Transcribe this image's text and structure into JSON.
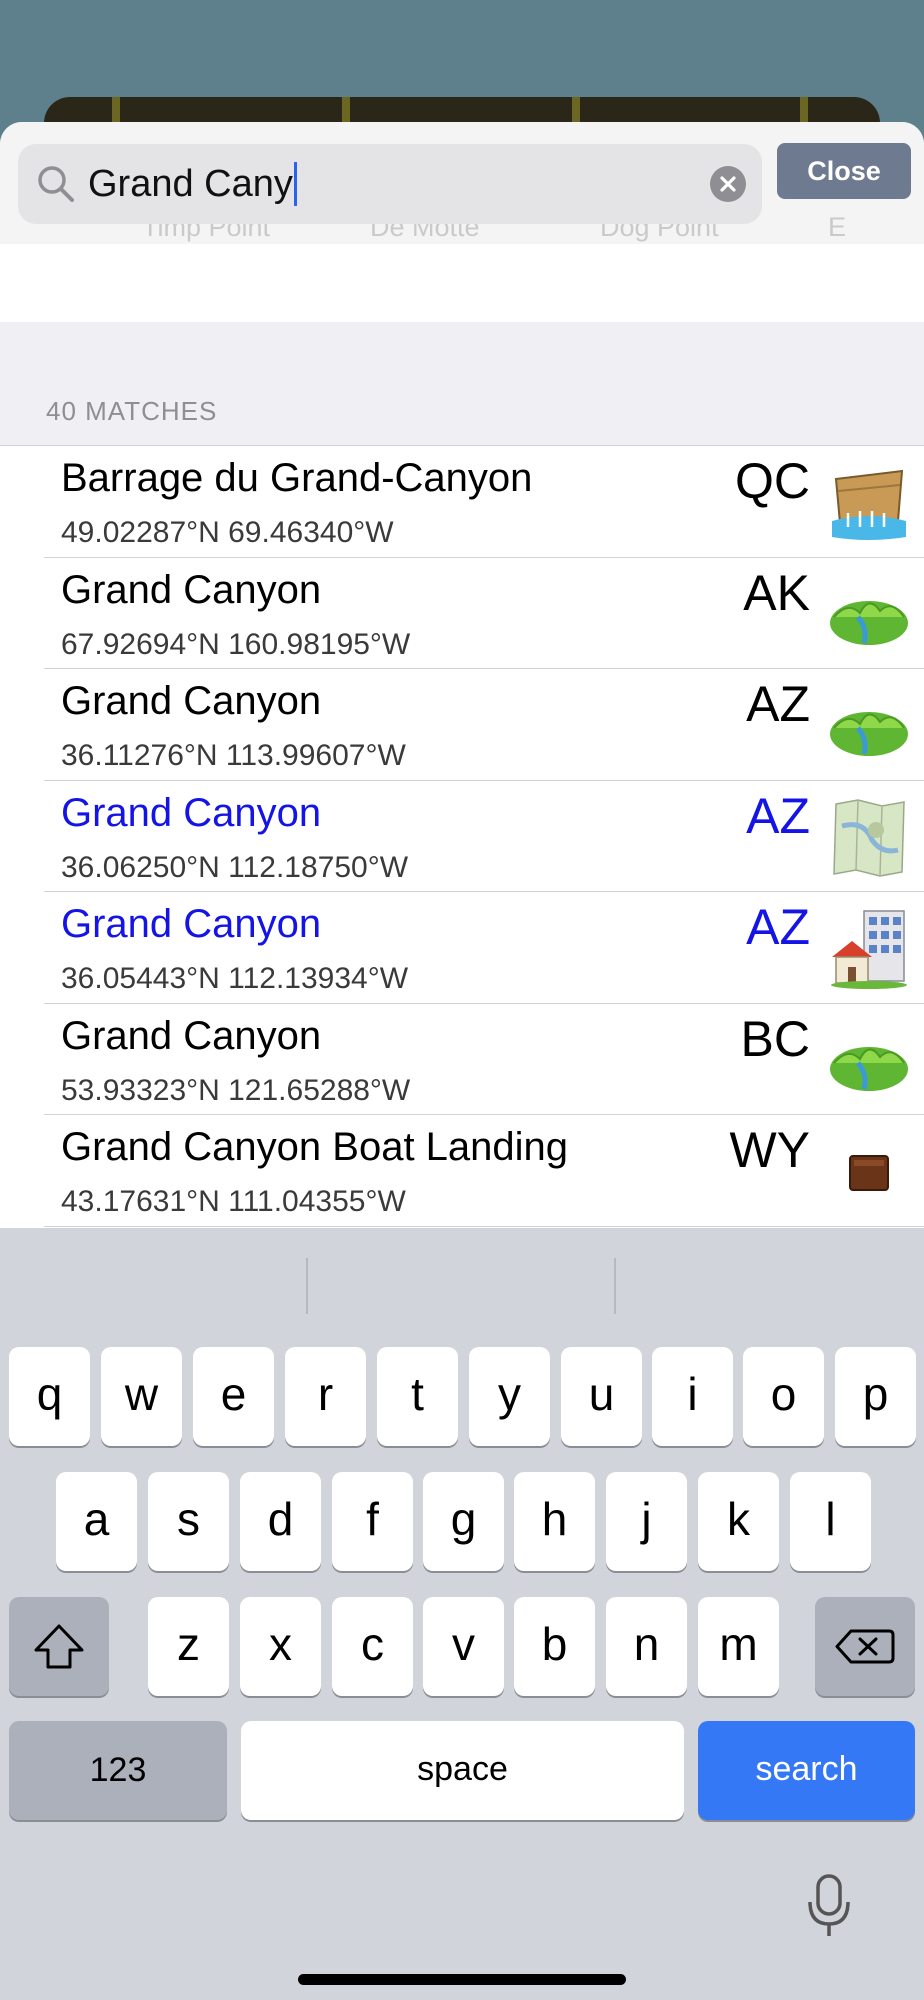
{
  "background_map": {
    "labels": [
      "Timp Point",
      "De Motte",
      "Dog Point",
      "E"
    ]
  },
  "search": {
    "query": "Grand Cany",
    "close_label": "Close"
  },
  "results": {
    "count_label": "40 MATCHES",
    "items": [
      {
        "name": "Barrage du Grand-Canyon",
        "coords": "49.02287°N 69.46340°W",
        "state": "QC",
        "icon": "dam-icon",
        "highlighted": false
      },
      {
        "name": "Grand Canyon",
        "coords": "67.92694°N 160.98195°W",
        "state": "AK",
        "icon": "valley-icon",
        "highlighted": false
      },
      {
        "name": "Grand Canyon",
        "coords": "36.11276°N 113.99607°W",
        "state": "AZ",
        "icon": "valley-icon",
        "highlighted": false
      },
      {
        "name": "Grand Canyon",
        "coords": "36.06250°N 112.18750°W",
        "state": "AZ",
        "icon": "map-icon",
        "highlighted": true
      },
      {
        "name": "Grand Canyon",
        "coords": "36.05443°N 112.13934°W",
        "state": "AZ",
        "icon": "town-icon",
        "highlighted": true
      },
      {
        "name": "Grand Canyon",
        "coords": "53.93323°N 121.65288°W",
        "state": "BC",
        "icon": "valley-icon",
        "highlighted": false
      },
      {
        "name": "Grand Canyon Boat Landing",
        "coords": "43.17631°N 111.04355°W",
        "state": "WY",
        "icon": "landing-icon",
        "highlighted": false
      }
    ]
  },
  "keyboard": {
    "row1": [
      "q",
      "w",
      "e",
      "r",
      "t",
      "y",
      "u",
      "i",
      "o",
      "p"
    ],
    "row2": [
      "a",
      "s",
      "d",
      "f",
      "g",
      "h",
      "j",
      "k",
      "l"
    ],
    "row3": [
      "z",
      "x",
      "c",
      "v",
      "b",
      "n",
      "m"
    ],
    "numbers_label": "123",
    "space_label": "space",
    "search_label": "search"
  },
  "colors": {
    "highlight_text": "#1414e6",
    "search_key": "#3478f6",
    "close_button": "#6e7a8f"
  }
}
